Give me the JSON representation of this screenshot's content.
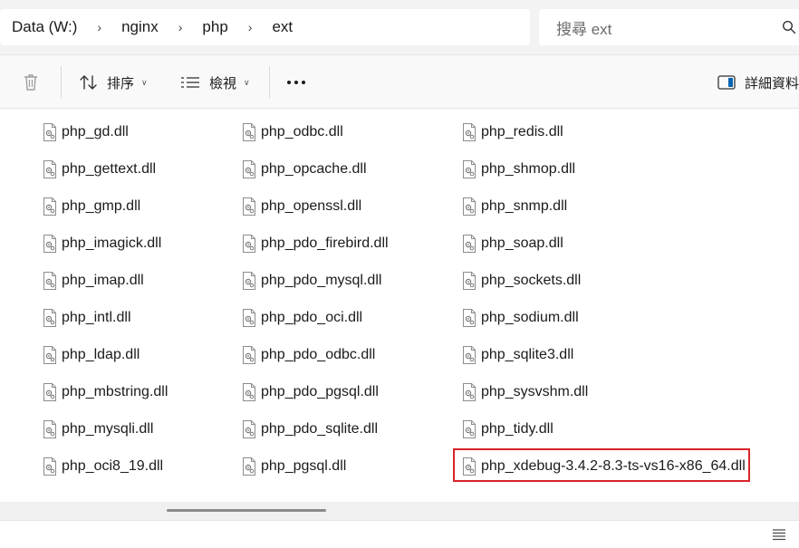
{
  "breadcrumb": {
    "items": [
      "Data (W:)",
      "nginx",
      "php",
      "ext"
    ]
  },
  "search": {
    "placeholder": "搜尋 ext"
  },
  "toolbar": {
    "sort_label": "排序",
    "view_label": "檢視",
    "details_label": "詳細資料"
  },
  "files": {
    "col1": [
      "php_gd.dll",
      "php_gettext.dll",
      "php_gmp.dll",
      "php_imagick.dll",
      "php_imap.dll",
      "php_intl.dll",
      "php_ldap.dll",
      "php_mbstring.dll",
      "php_mysqli.dll",
      "php_oci8_19.dll"
    ],
    "col2": [
      "php_odbc.dll",
      "php_opcache.dll",
      "php_openssl.dll",
      "php_pdo_firebird.dll",
      "php_pdo_mysql.dll",
      "php_pdo_oci.dll",
      "php_pdo_odbc.dll",
      "php_pdo_pgsql.dll",
      "php_pdo_sqlite.dll",
      "php_pgsql.dll"
    ],
    "col3": [
      "php_redis.dll",
      "php_shmop.dll",
      "php_snmp.dll",
      "php_soap.dll",
      "php_sockets.dll",
      "php_sodium.dll",
      "php_sqlite3.dll",
      "php_sysvshm.dll",
      "php_tidy.dll",
      "php_xdebug-3.4.2-8.3-ts-vs16-x86_64.dll"
    ]
  },
  "colors": {
    "highlight_border": "#d9232a",
    "accent": "#0063b1"
  },
  "icons": {
    "delete": "trash-icon",
    "sort": "sort-arrows-icon",
    "view": "list-view-icon",
    "more": "ellipsis-icon",
    "details": "details-pane-icon",
    "file": "dll-file-icon"
  }
}
